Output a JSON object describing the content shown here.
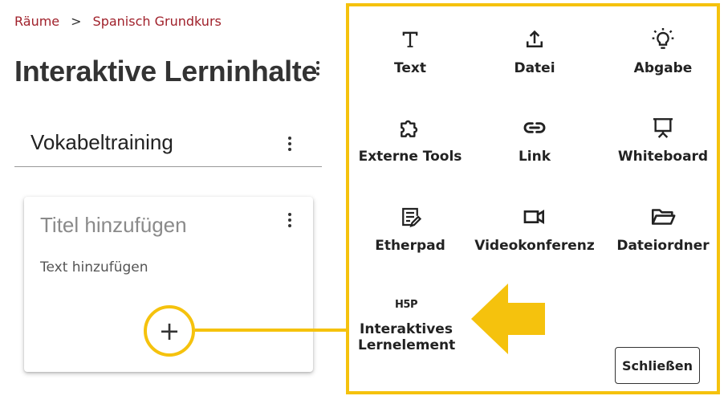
{
  "breadcrumb": {
    "items": [
      "Räume",
      "Spanisch Grundkurs"
    ],
    "separator": ">"
  },
  "page": {
    "title": "Interaktive Lerninhalte"
  },
  "section": {
    "title": "Vokabeltraining"
  },
  "card": {
    "title_placeholder": "Titel hinzufügen",
    "text_placeholder": "Text hinzufügen",
    "add_symbol": "+"
  },
  "panel": {
    "tools": [
      {
        "label": "Text",
        "icon": "text-icon"
      },
      {
        "label": "Datei",
        "icon": "upload-icon"
      },
      {
        "label": "Abgabe",
        "icon": "lightbulb-icon"
      },
      {
        "label": "Externe Tools",
        "icon": "puzzle-icon"
      },
      {
        "label": "Link",
        "icon": "link-icon"
      },
      {
        "label": "Whiteboard",
        "icon": "presentation-board-icon"
      },
      {
        "label": "Etherpad",
        "icon": "document-edit-icon"
      },
      {
        "label": "Videokonferenz",
        "icon": "video-camera-icon"
      },
      {
        "label": "Dateiordner",
        "icon": "folder-open-icon"
      },
      {
        "label": "Interaktives Lernelement",
        "icon": "h5p-icon",
        "icon_text": "H5P"
      }
    ],
    "close_label": "Schließen"
  },
  "colors": {
    "accent": "#f5c20d",
    "breadcrumb": "#a0212b",
    "text": "#222222"
  }
}
